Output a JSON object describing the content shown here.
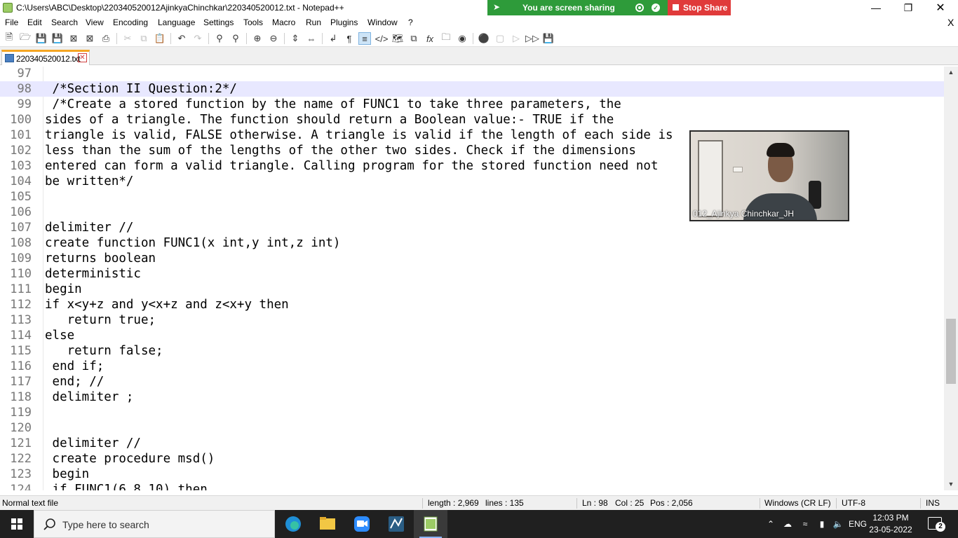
{
  "window": {
    "title": "C:\\Users\\ABC\\Desktop\\220340520012AjinkyaChinchkar\\220340520012.txt - Notepad++",
    "minimize": "—",
    "maximize": "❐",
    "close": "✕"
  },
  "screen_share": {
    "message": "You are screen sharing",
    "stop_label": "Stop Share",
    "banner_color": "#2e9b3a",
    "stop_color": "#e03a3a"
  },
  "menu": {
    "items": [
      "File",
      "Edit",
      "Search",
      "View",
      "Encoding",
      "Language",
      "Settings",
      "Tools",
      "Macro",
      "Run",
      "Plugins",
      "Window",
      "?"
    ],
    "close_doc": "X"
  },
  "toolbar": {
    "icons": [
      "new-file-icon",
      "open-file-icon",
      "save-icon",
      "save-all-icon",
      "close-icon",
      "close-all-icon",
      "print-icon",
      "cut-icon",
      "copy-icon",
      "paste-icon",
      "undo-icon",
      "redo-icon",
      "find-icon",
      "replace-icon",
      "zoom-in-icon",
      "zoom-out-icon",
      "sync-vertical-icon",
      "sync-horizontal-icon",
      "word-wrap-icon",
      "show-all-chars-icon",
      "indent-guide-icon",
      "user-lang-icon",
      "doc-map-icon",
      "doc-list-icon",
      "function-list-icon",
      "folder-workspace-icon",
      "monitoring-icon",
      "record-macro-icon",
      "stop-macro-icon",
      "play-macro-icon",
      "run-macro-multiple-icon",
      "save-macro-icon"
    ]
  },
  "tab": {
    "label": "220340520012.txt",
    "close": "✕",
    "accent": "#f5a623"
  },
  "editor": {
    "current_line": 98,
    "lines": [
      {
        "num": "97",
        "text": ""
      },
      {
        "num": "98",
        "text": " /*Section II Question:2*/"
      },
      {
        "num": "99",
        "text": " /*Create a stored function by the name of FUNC1 to take three parameters, the"
      },
      {
        "num": "100",
        "text": "sides of a triangle. The function should return a Boolean value:- TRUE if the"
      },
      {
        "num": "101",
        "text": "triangle is valid, FALSE otherwise. A triangle is valid if the length of each side is"
      },
      {
        "num": "102",
        "text": "less than the sum of the lengths of the other two sides. Check if the dimensions"
      },
      {
        "num": "103",
        "text": "entered can form a valid triangle. Calling program for the stored function need not"
      },
      {
        "num": "104",
        "text": "be written*/"
      },
      {
        "num": "105",
        "text": ""
      },
      {
        "num": "106",
        "text": ""
      },
      {
        "num": "107",
        "text": "delimiter //"
      },
      {
        "num": "108",
        "text": "create function FUNC1(x int,y int,z int)"
      },
      {
        "num": "109",
        "text": "returns boolean"
      },
      {
        "num": "110",
        "text": "deterministic"
      },
      {
        "num": "111",
        "text": "begin"
      },
      {
        "num": "112",
        "text": "if x<y+z and y<x+z and z<x+y then"
      },
      {
        "num": "113",
        "text": "   return true;"
      },
      {
        "num": "114",
        "text": "else"
      },
      {
        "num": "115",
        "text": "   return false;"
      },
      {
        "num": "116",
        "text": " end if;"
      },
      {
        "num": "117",
        "text": " end; //"
      },
      {
        "num": "118",
        "text": " delimiter ;"
      },
      {
        "num": "119",
        "text": ""
      },
      {
        "num": "120",
        "text": ""
      },
      {
        "num": "121",
        "text": " delimiter //"
      },
      {
        "num": "122",
        "text": " create procedure msd()"
      },
      {
        "num": "123",
        "text": " begin"
      },
      {
        "num": "124",
        "text": " if FUNC1(6,8,10) then"
      }
    ]
  },
  "webcam": {
    "participant": "012_Ajinkya Chinchkar_JH"
  },
  "statusbar": {
    "file_type": "Normal text file",
    "length": "length : 2,969",
    "lines": "lines : 135",
    "ln": "Ln : 98",
    "col": "Col : 25",
    "pos": "Pos : 2,056",
    "eol": "Windows (CR LF)",
    "encoding": "UTF-8",
    "mode": "INS"
  },
  "taskbar": {
    "search_placeholder": "Type here to search",
    "apps": [
      "edge-icon",
      "file-explorer-icon",
      "zoom-icon",
      "mysql-workbench-icon",
      "notepadpp-icon"
    ],
    "language": "ENG",
    "time": "12:03 PM",
    "date": "23-05-2022",
    "notifications": "2"
  }
}
